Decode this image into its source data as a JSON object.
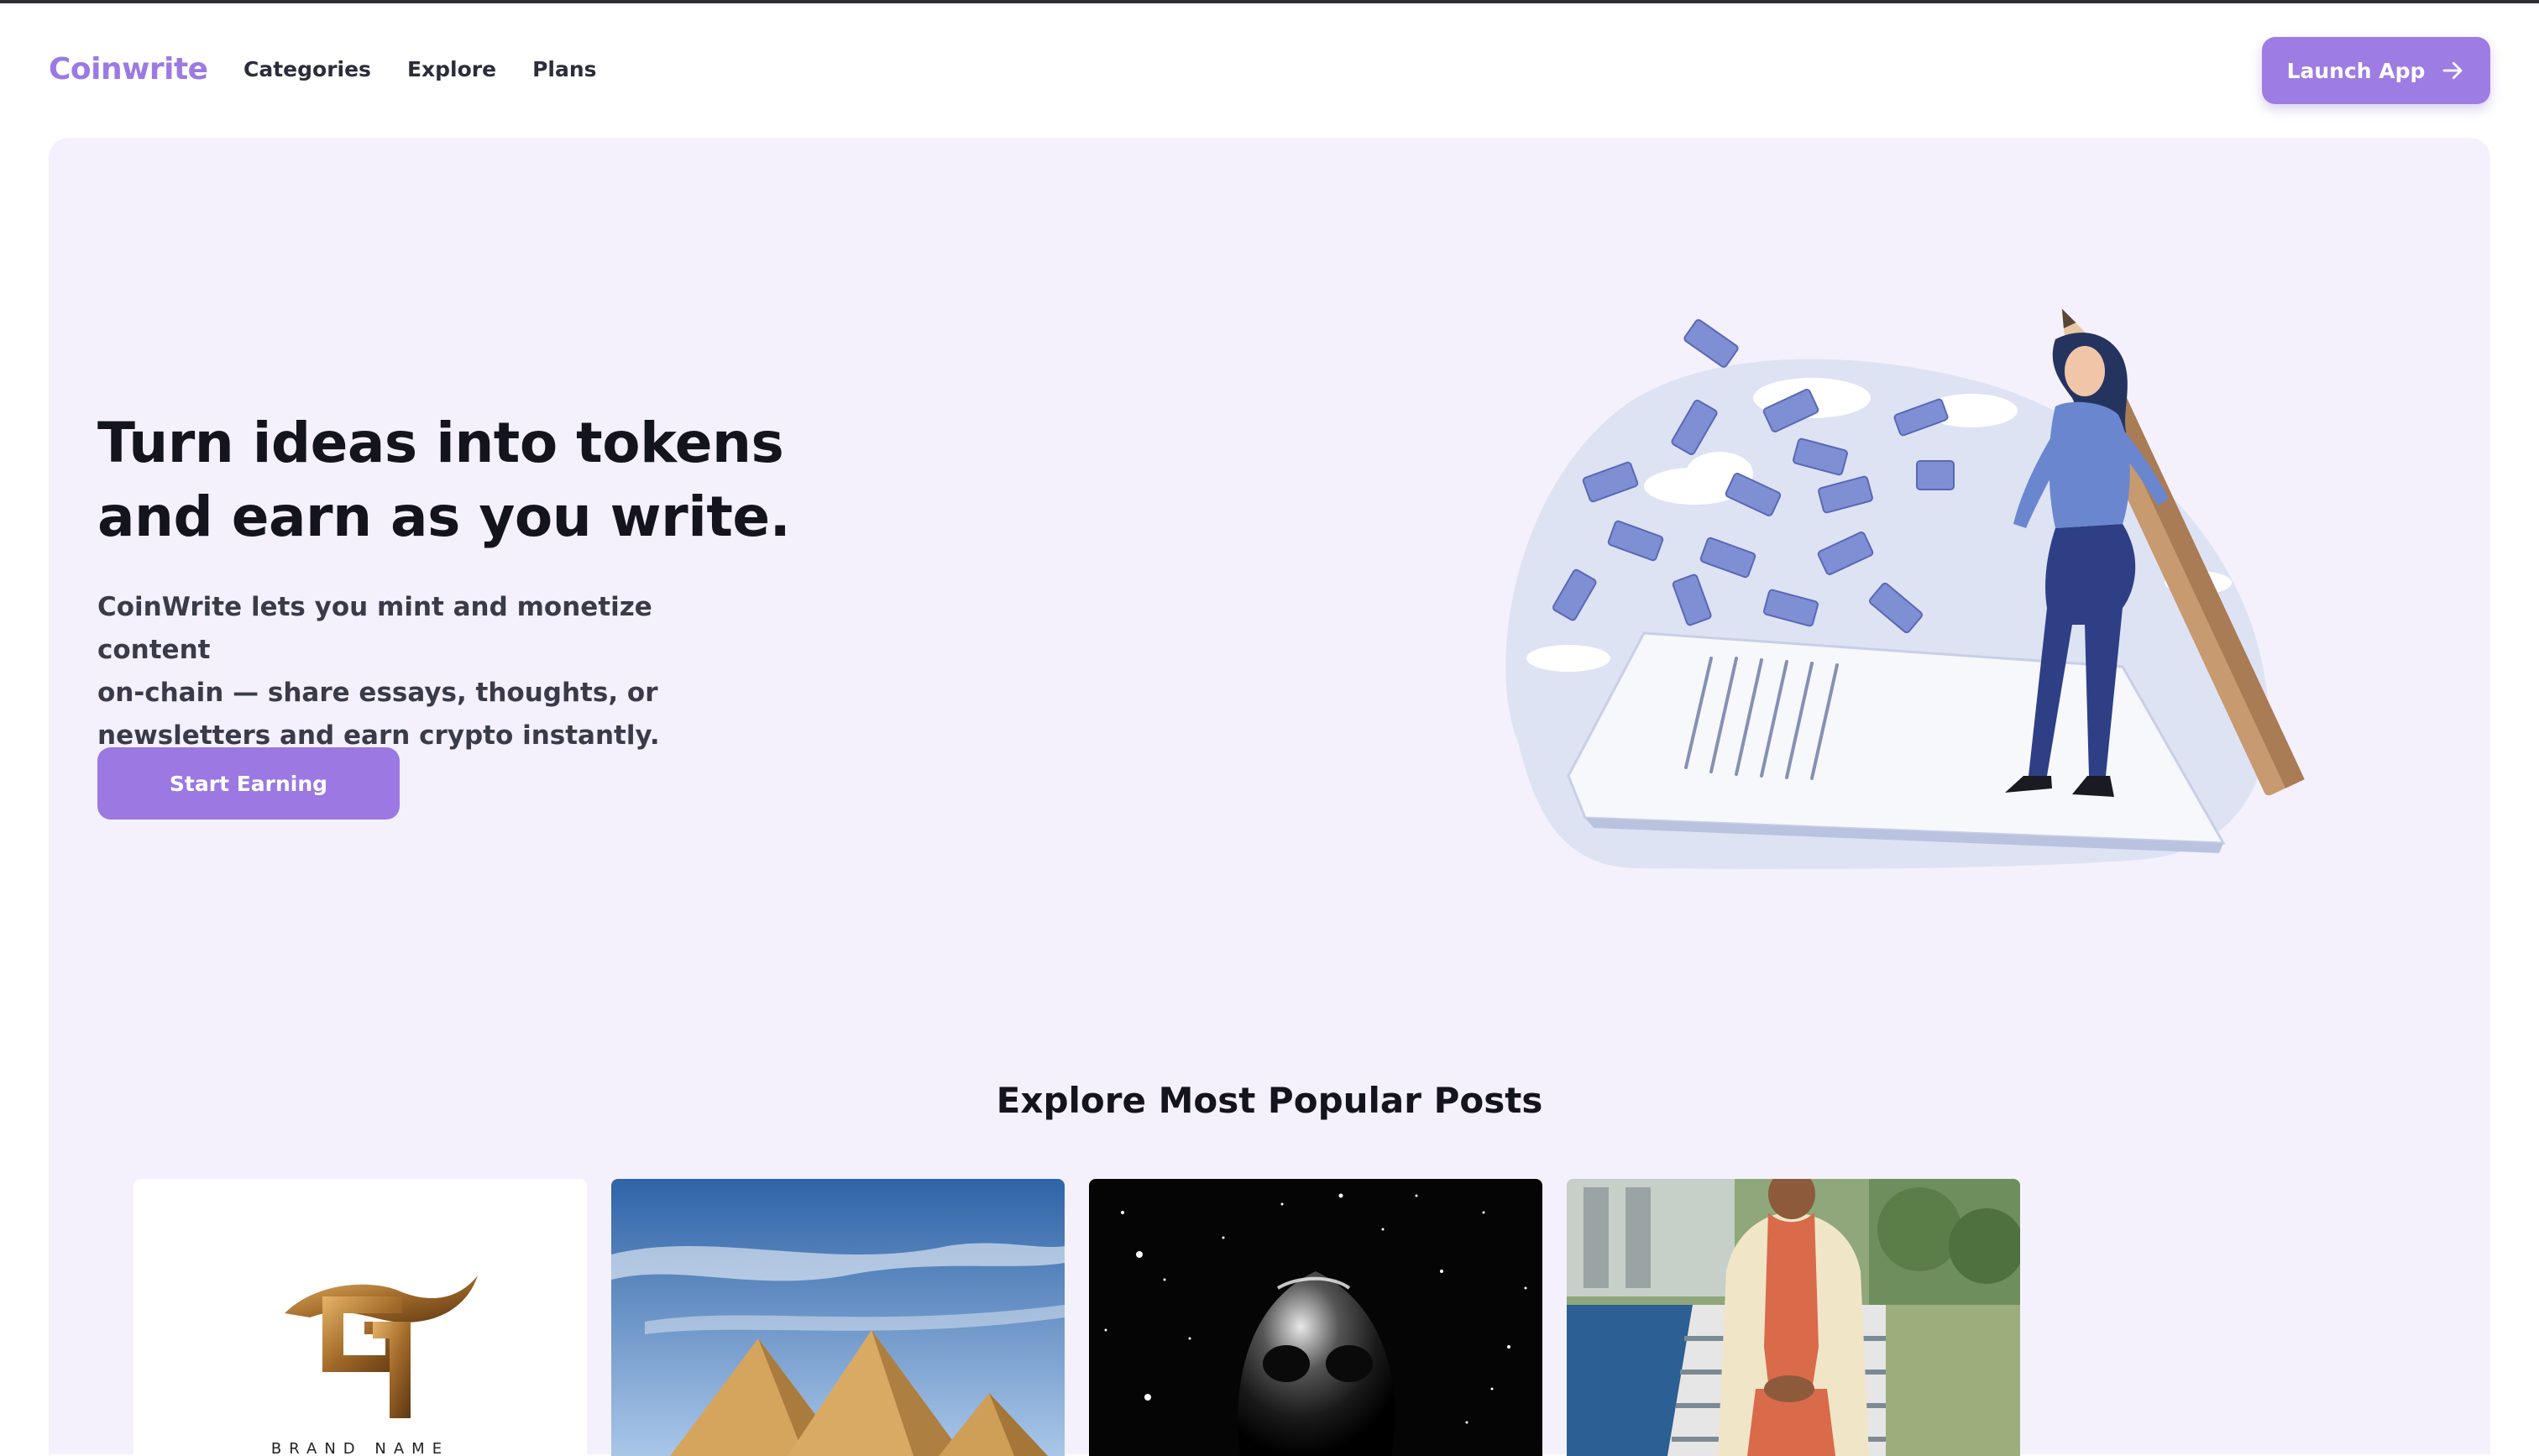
{
  "brand": {
    "name": "Coinwrite",
    "accent": "#9b78e2"
  },
  "nav": {
    "items": [
      {
        "label": "Categories"
      },
      {
        "label": "Explore"
      },
      {
        "label": "Plans"
      }
    ]
  },
  "header": {
    "launch_label": "Launch App",
    "launch_icon": "arrow-right-icon"
  },
  "hero": {
    "title_line1": "Turn ideas into tokens",
    "title_line2": "and earn as you write.",
    "desc_line1": "CoinWrite lets you mint and monetize content",
    "desc_line2": "on-chain — share essays, thoughts, or",
    "desc_line3": "newsletters and earn crypto instantly.",
    "cta_label": "Start Earning",
    "background": "#f4f1fc"
  },
  "popular": {
    "title": "Explore Most Popular Posts",
    "cards": [
      {
        "image": "brand-logo-image",
        "caption": "BRAND NAME"
      },
      {
        "image": "pyramids-image"
      },
      {
        "image": "chrome-skull-space-image"
      },
      {
        "image": "man-in-traditional-outfit-image"
      }
    ]
  }
}
